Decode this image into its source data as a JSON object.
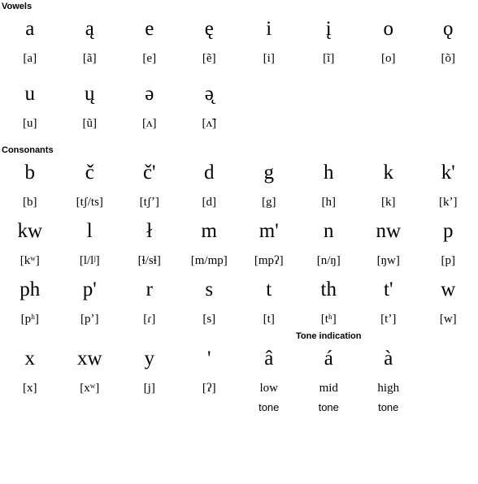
{
  "sections": {
    "vowels": {
      "heading": "Vowels",
      "rows": [
        {
          "letters": [
            "a",
            "ą",
            "e",
            "ę",
            "i",
            "į",
            "o",
            "ǫ"
          ],
          "ipa": [
            "[a]",
            "[ã]",
            "[e]",
            "[ẽ]",
            "[i]",
            "[ĩ]",
            "[o]",
            "[õ]"
          ]
        },
        {
          "letters": [
            "u",
            "ų",
            "ə",
            "ə̨",
            "",
            "",
            "",
            ""
          ],
          "ipa": [
            "[u]",
            "[ũ]",
            "[ʌ]",
            "[ʌ̃]",
            "",
            "",
            "",
            ""
          ]
        }
      ]
    },
    "consonants": {
      "heading": "Consonants",
      "rows": [
        {
          "letters": [
            "b",
            "č",
            "č'",
            "d",
            "g",
            "h",
            "k",
            "k'"
          ],
          "ipa": [
            "[b]",
            "[tʃ/ts]",
            "[tʃʼ]",
            "[d]",
            "[g]",
            "[h]",
            "[k]",
            "[kʼ]"
          ]
        },
        {
          "letters": [
            "kw",
            "l",
            "ł",
            "m",
            "m'",
            "n",
            "nw",
            "p"
          ],
          "ipa": [
            "[kʷ]",
            "[l/lʲ]",
            "[ɬ/sɬ]",
            "[m/mp]",
            "[mpʔ]",
            "[n/ŋ]",
            "[ŋw]",
            "[p]"
          ]
        },
        {
          "letters": [
            "ph",
            "p'",
            "r",
            "s",
            "t",
            "th",
            "t'",
            "w"
          ],
          "ipa": [
            "[pʰ]",
            "[pʼ]",
            "[ɾ]",
            "[s]",
            "[t]",
            "[tʰ]",
            "[tʼ]",
            "[w]"
          ]
        },
        {
          "letters": [
            "x",
            "xw",
            "y",
            "'",
            "",
            "",
            "",
            ""
          ],
          "ipa": [
            "[x]",
            "[xʷ]",
            "[j]",
            "[ʔ]",
            "",
            "",
            "",
            ""
          ]
        }
      ]
    },
    "tone": {
      "heading": "Tone indication",
      "letters": [
        "â",
        "á",
        "à"
      ],
      "labels_line1": [
        "low",
        "mid",
        "high"
      ],
      "labels_line2": [
        "tone",
        "tone",
        "tone"
      ]
    }
  }
}
